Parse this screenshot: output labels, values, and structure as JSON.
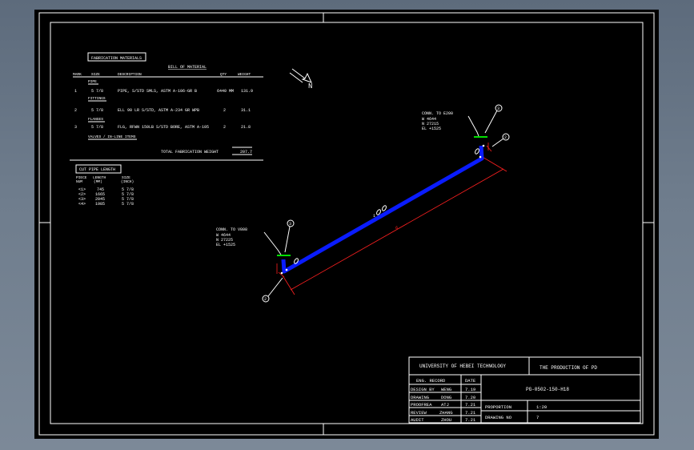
{
  "bom": {
    "tab_label": "FABRICATION MATERIALS",
    "title": "BILL OF MATERIAL",
    "headers": {
      "mark": "MARK",
      "size": "SIZE",
      "description": "DESCRIPTION",
      "qty": "QTY",
      "weight": "WEIGHT"
    },
    "section_pipe": "PIPE",
    "section_fittings": "FITTINGS",
    "section_flanges": "FLANGES",
    "section_valves": "VALVES / IN-LINE ITEMS",
    "rows": [
      {
        "mark": "1",
        "size": "5 7/8",
        "description": "PIPE, S/STD SMLS, ASTM A-106-GR B",
        "qty": "6440 MM",
        "weight": "131.9"
      },
      {
        "mark": "2",
        "size": "5 7/8",
        "description": "ELL 90 LR S/STD, ASTM A-234 GR WPB",
        "qty": "2",
        "weight": "31.1"
      },
      {
        "mark": "3",
        "size": "5 7/8",
        "description": "FLG, RFWN 150LB S/STD BORE, ASTM A-105",
        "qty": "2",
        "weight": "21.8"
      }
    ],
    "total_label": "TOTAL FABRICATION WEIGHT",
    "total_value": "207.7"
  },
  "cut_list": {
    "title": "CUT PIPE LENGTH",
    "headers": {
      "piece": "PIECE",
      "piece_sub": "NUM",
      "length": "LENGTH",
      "length_sub": "(MM)",
      "size": "SIZE",
      "size_sub": "(INCH)"
    },
    "rows": [
      {
        "piece": "<1>",
        "length": "745",
        "size": "5 7/8"
      },
      {
        "piece": "<2>",
        "length": "1665",
        "size": "5 7/8"
      },
      {
        "piece": "<3>",
        "length": "2045",
        "size": "5 7/8"
      },
      {
        "piece": "<4>",
        "length": "1985",
        "size": "5 7/8"
      }
    ]
  },
  "north_label": "N",
  "conn_upper": {
    "line1": "CONN. TO  E200",
    "line2": "W 4644",
    "line3": "N 27215",
    "line4": "EL +1525"
  },
  "conn_lower": {
    "line1": "CONN. TO  V808",
    "line2": "W 4644",
    "line3": "N 27225",
    "line4": "EL +1525"
  },
  "balloons": {
    "b1": "3",
    "b2": "2",
    "b3": "3",
    "b4": "2"
  },
  "pipe_label": "1",
  "dim_label": "6",
  "title_block": {
    "university": "UNIVERSITY OF HEBEI TECHNOLOGY",
    "project": "THE PRODUCTION OF PD",
    "record_header": "ENG. RECORD",
    "date_header": "DATE",
    "drawing_no": "PG-0502-150-H18",
    "records": [
      {
        "role": "DESIGN BY",
        "name": "WENG",
        "date": "7.19"
      },
      {
        "role": "DRAWING",
        "name": "DONG",
        "date": "7.20"
      },
      {
        "role": "PROOFREA",
        "name": "ATJ",
        "date": "7.21"
      },
      {
        "role": "REVIEW",
        "name": "ZHANG",
        "date": "7.21"
      },
      {
        "role": "AUDIT",
        "name": "ZHOU",
        "date": "7.21"
      }
    ],
    "proportion_label": "PROPORTION",
    "proportion_value": "1:20",
    "drawing_no_label": "DRAWING NO",
    "drawing_no_value": "7"
  },
  "colors": {
    "background": "#000000",
    "line": "#ffffff",
    "pipe": "#0a1cff",
    "dimension": "#ff2020",
    "flange": "#00e000",
    "chrome": "#6f7d8d"
  }
}
